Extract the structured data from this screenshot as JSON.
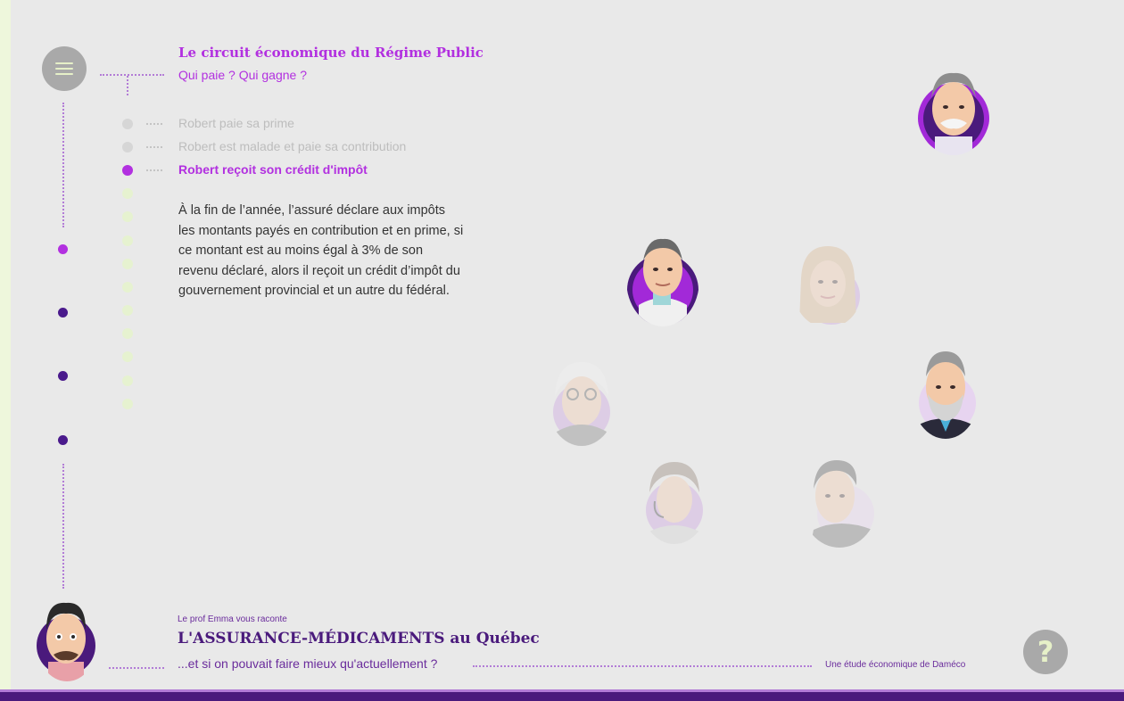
{
  "header": {
    "title": "Le circuit économique du Régime Public",
    "subtitle": "Qui paie ? Qui gagne ?"
  },
  "steps": [
    {
      "label": "Robert paie sa prime",
      "state": "visited"
    },
    {
      "label": "Robert est malade et paie sa contribution",
      "state": "visited"
    },
    {
      "label": "Robert reçoit son crédit d'impôt",
      "state": "active"
    }
  ],
  "content": {
    "body": "À la fin de l’année, l’assuré déclare aux impôts les montants payés en contribution et en prime, si ce montant est au moins égal à 3% de son revenu déclaré, alors il reçoit un crédit d’impôt du gouvernement provincial et un autre du fédéral."
  },
  "footer": {
    "intro": "Le prof Emma vous raconte",
    "title": "L'ASSURANCE-MÉDICAMENTS au Québec",
    "subtitle": "...et si on pouvait faire mieux qu'actuellement ?",
    "credit": "Une étude économique de Daméco"
  },
  "help": {
    "label": "?"
  },
  "colors": {
    "accent": "#b230e0",
    "dark_purple": "#4a1a7c",
    "background": "#e9e9e9",
    "light_green": "#e6f2d0"
  },
  "icons": {
    "menu": "hamburger-icon",
    "help": "question-icon"
  }
}
